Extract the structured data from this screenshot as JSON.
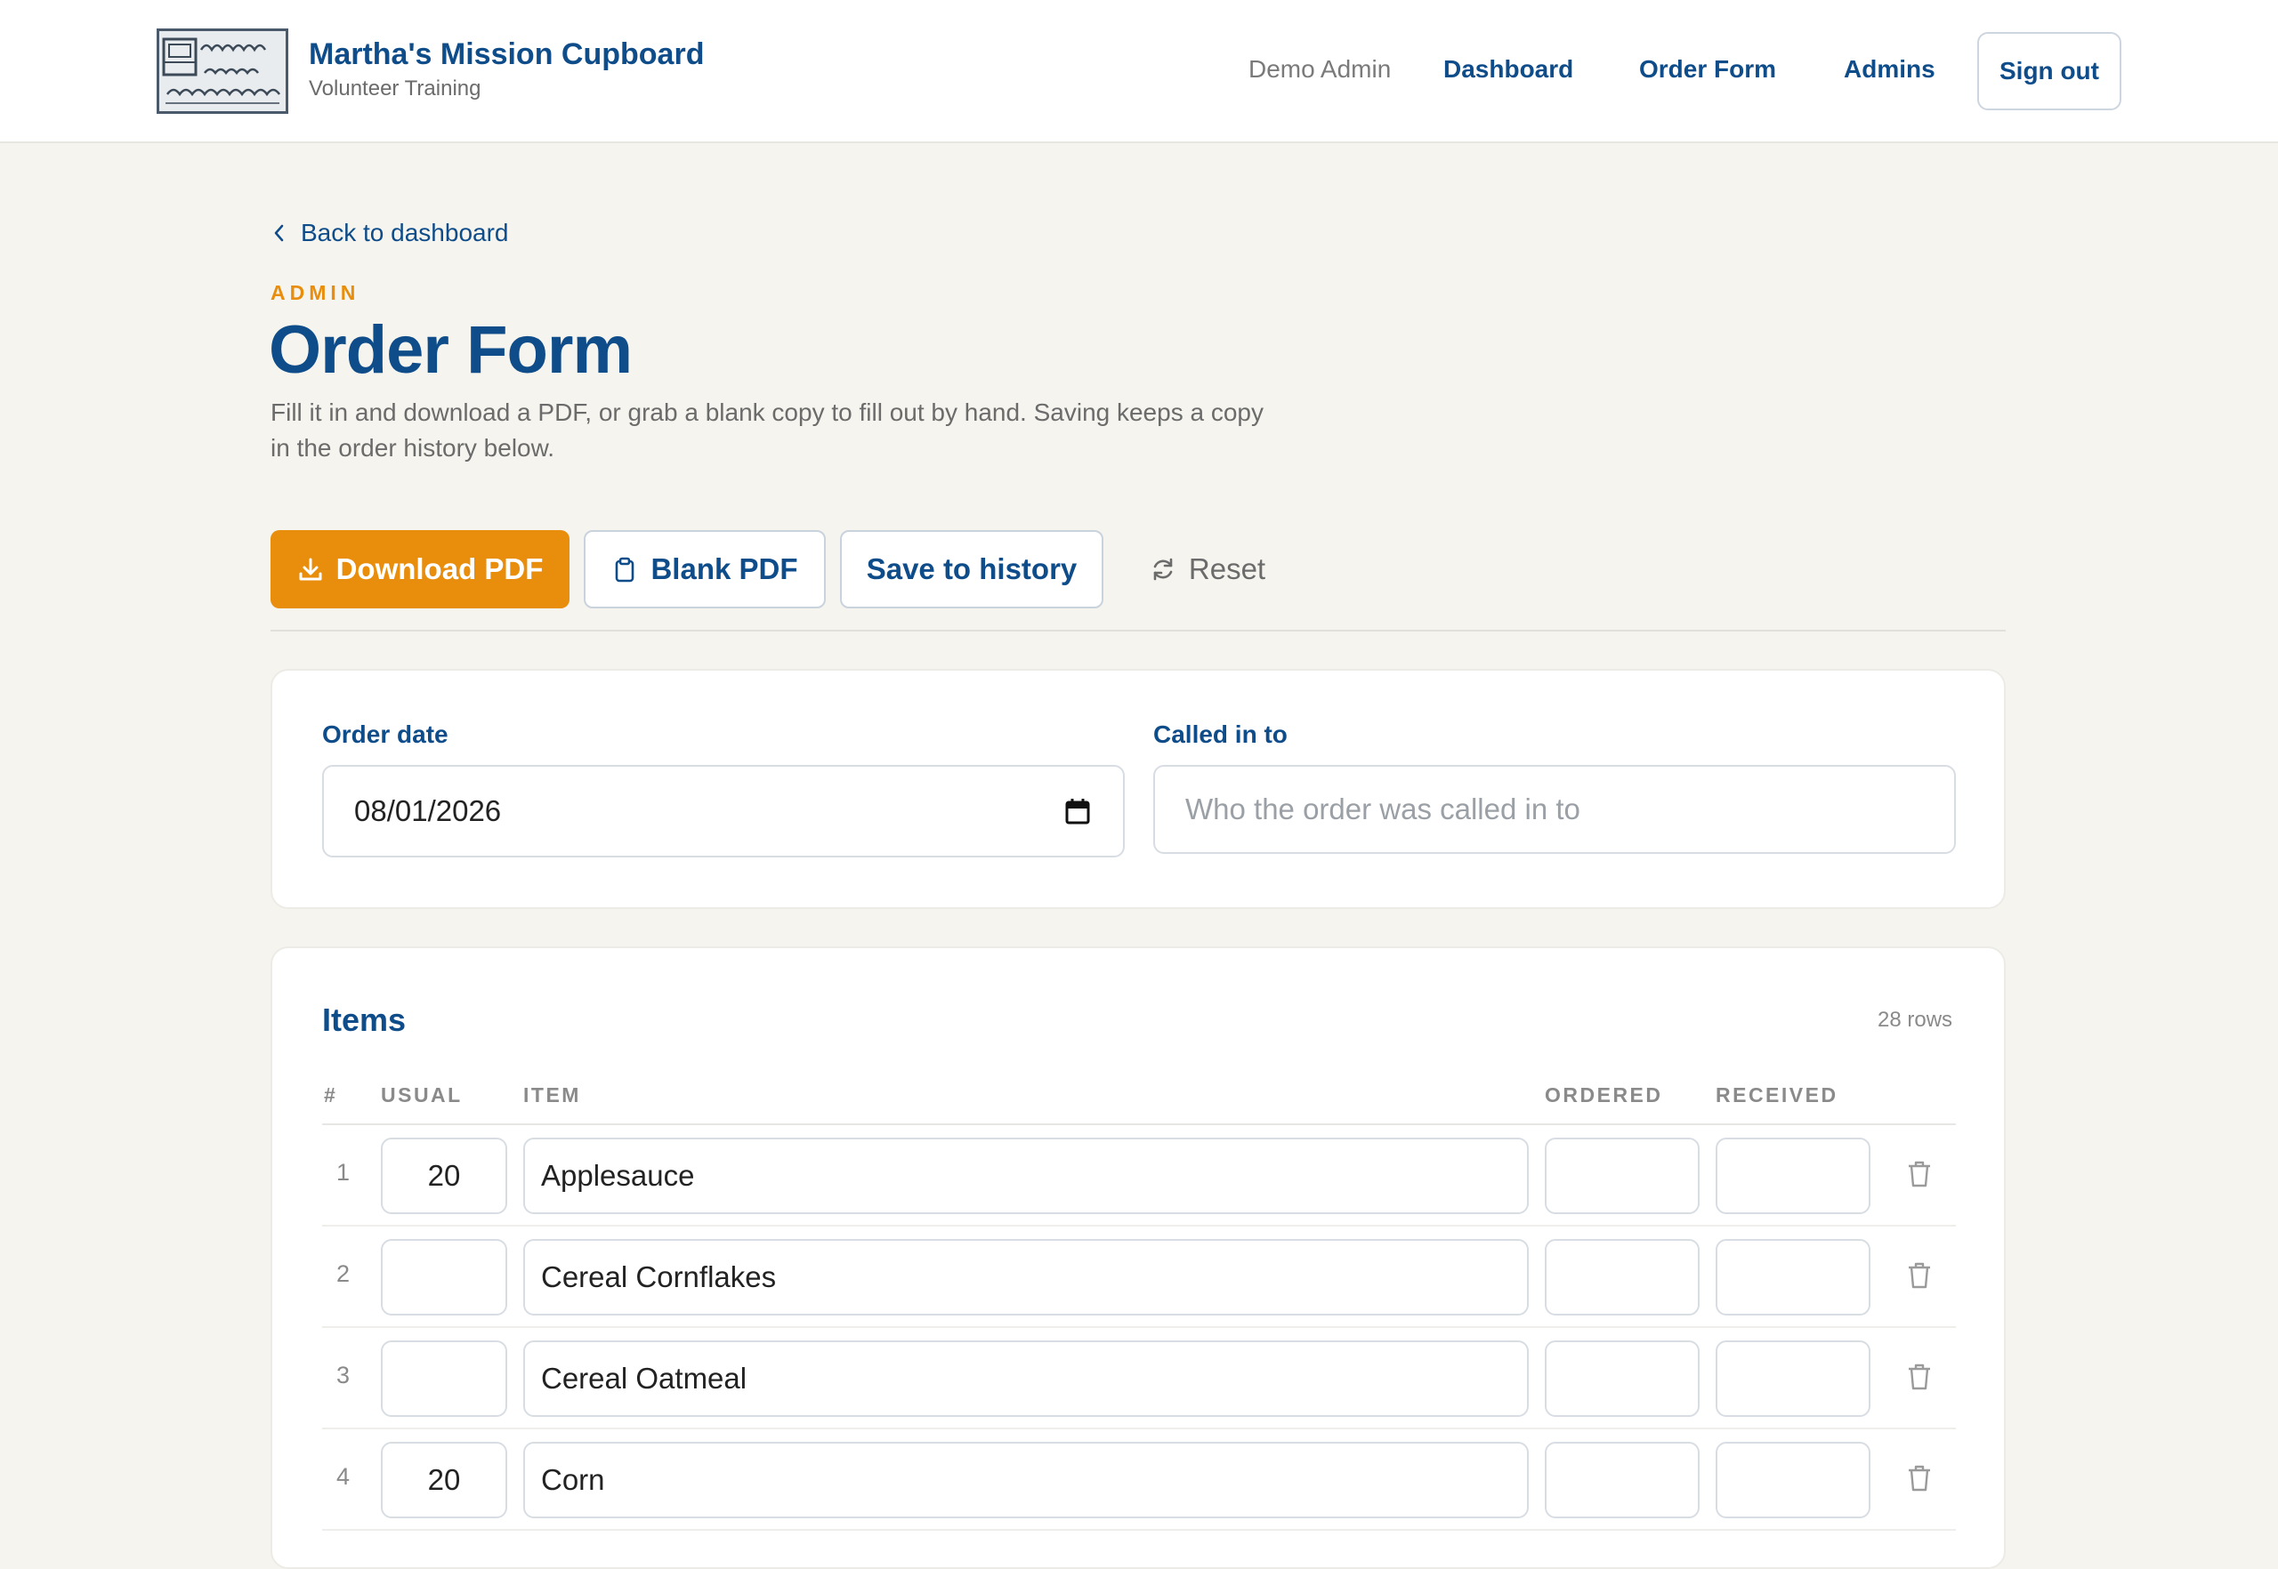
{
  "header": {
    "brand_name": "Martha's Mission Cupboard",
    "brand_sub": "Volunteer Training",
    "logo_text": "martha's mission cupboard inc.",
    "user": "Demo Admin",
    "nav": [
      "Dashboard",
      "Order Form",
      "Admins"
    ],
    "sign_out": "Sign out"
  },
  "page": {
    "back": "Back to dashboard",
    "eyebrow": "ADMIN",
    "title": "Order Form",
    "description": "Fill it in and download a PDF, or grab a blank copy to fill out by hand. Saving keeps a copy in the order history below."
  },
  "actions": {
    "download": "Download PDF",
    "blank": "Blank PDF",
    "save": "Save to history",
    "reset": "Reset"
  },
  "meta": {
    "order_date_label": "Order date",
    "order_date_value": "08/01/2026",
    "called_in_label": "Called in to",
    "called_in_placeholder": "Who the order was called in to"
  },
  "items": {
    "title": "Items",
    "row_count": "28 rows",
    "columns": [
      "#",
      "USUAL",
      "ITEM",
      "ORDERED",
      "RECEIVED"
    ],
    "rows": [
      {
        "num": "1",
        "usual": "20",
        "item": "Applesauce",
        "ordered": "",
        "received": ""
      },
      {
        "num": "2",
        "usual": "",
        "item": "Cereal Cornflakes",
        "ordered": "",
        "received": ""
      },
      {
        "num": "3",
        "usual": "",
        "item": "Cereal Oatmeal",
        "ordered": "",
        "received": ""
      },
      {
        "num": "4",
        "usual": "20",
        "item": "Corn",
        "ordered": "",
        "received": ""
      }
    ]
  },
  "colors": {
    "brand_blue": "#0f4c8a",
    "accent_orange": "#e88d0c",
    "page_bg": "#f5f4ee"
  }
}
